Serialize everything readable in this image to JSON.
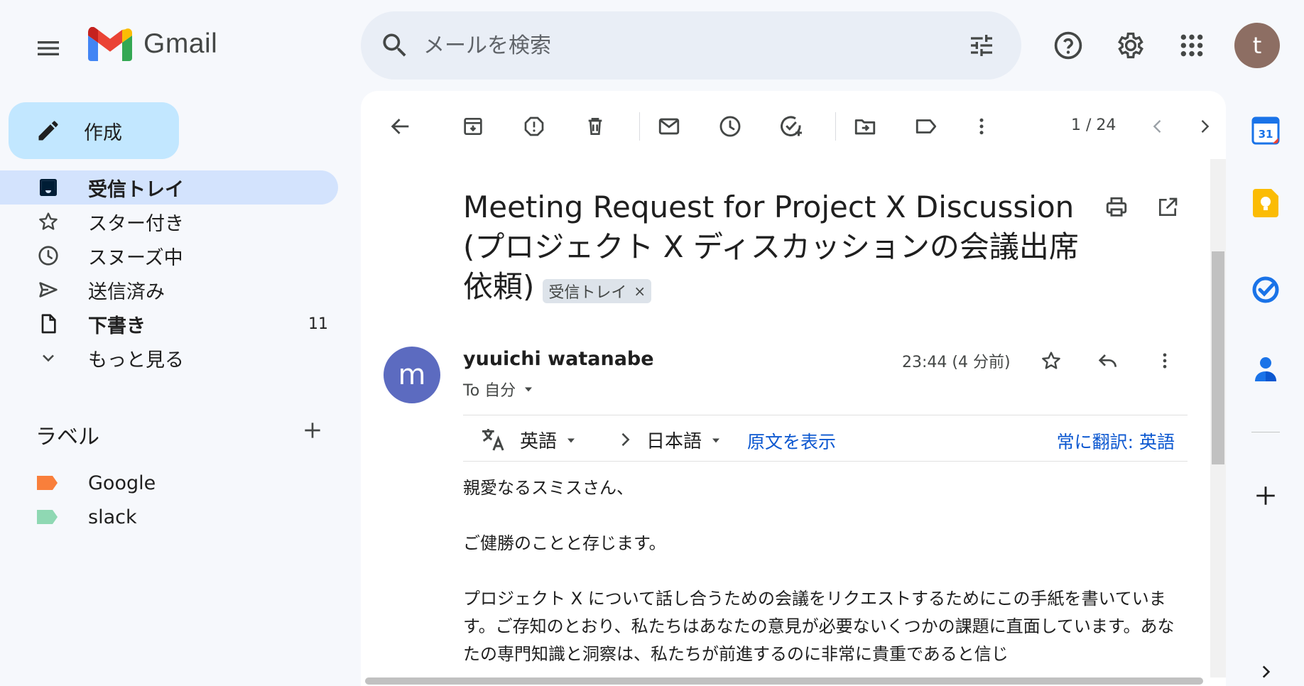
{
  "header": {
    "logo_text": "Gmail",
    "search_placeholder": "メールを検索",
    "avatar_letter": "t"
  },
  "sidebar": {
    "compose_label": "作成",
    "items": [
      {
        "label": "受信トレイ",
        "icon": "inbox-icon",
        "active": true,
        "bold": true,
        "count": ""
      },
      {
        "label": "スター付き",
        "icon": "star-icon",
        "active": false,
        "bold": false,
        "count": ""
      },
      {
        "label": "スヌーズ中",
        "icon": "clock-icon",
        "active": false,
        "bold": false,
        "count": ""
      },
      {
        "label": "送信済み",
        "icon": "send-icon",
        "active": false,
        "bold": false,
        "count": ""
      },
      {
        "label": "下書き",
        "icon": "draft-icon",
        "active": false,
        "bold": true,
        "count": "11"
      },
      {
        "label": "もっと見る",
        "icon": "chevron-down-icon",
        "active": false,
        "bold": false,
        "count": ""
      }
    ],
    "labels_heading": "ラベル",
    "labels": [
      {
        "name": "Google",
        "color": "#f97f3b"
      },
      {
        "name": "slack",
        "color": "#8fd8b3"
      }
    ]
  },
  "toolbar": {
    "pager": "1 / 24"
  },
  "email": {
    "subject": "Meeting Request for Project X Discussion (プロジェクト X ディスカッションの会議出席依頼)",
    "label_chip": "受信トレイ",
    "label_chip_close": "×",
    "sender_initial": "m",
    "sender_name": "yuuichi watanabe",
    "recipient": "To 自分",
    "timestamp": "23:44 (4 分前)",
    "translate": {
      "source_lang": "英語",
      "target_lang": "日本語",
      "show_original": "原文を表示",
      "always_translate": "常に翻訳: 英語"
    },
    "body": [
      "親愛なるスミスさん、",
      "ご健勝のことと存じます。",
      "プロジェクト X について話し合うための会議をリクエストするためにこの手紙を書いています。ご存知のとおり、私たちはあなたの意見が必要ないくつかの課題に直面しています。あなたの専門知識と洞察は、私たちが前進するのに非常に貴重であると信じ"
    ]
  },
  "colors": {
    "background": "#f6f8fc",
    "compose_bg": "#c2e7ff",
    "active_nav_bg": "#d3e3fd",
    "link_blue": "#0b57d0",
    "sender_avatar": "#5c6bc0",
    "user_avatar": "#8d6e63"
  }
}
